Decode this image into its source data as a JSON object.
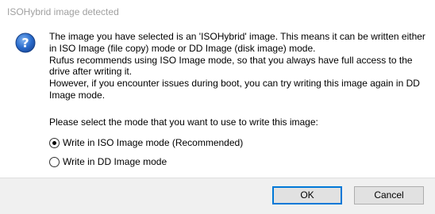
{
  "window": {
    "title": "ISOHybrid image detected"
  },
  "icon": {
    "name": "question-icon",
    "glyph": "?",
    "color": "#1f5fbf"
  },
  "message": {
    "lines": [
      "The image you have selected is an 'ISOHybrid' image. This means it can be written either",
      "in ISO Image (file copy) mode or DD Image (disk image) mode.",
      "Rufus recommends using ISO Image mode, so that you always have full access to the",
      "drive after writing it.",
      "However, if you encounter issues during boot, you can try writing this image again in DD",
      "Image mode."
    ]
  },
  "prompt": "Please select the mode that you want to use to write this image:",
  "options": [
    {
      "label": "Write in ISO Image mode (Recommended)",
      "selected": true
    },
    {
      "label": "Write in DD Image mode",
      "selected": false
    }
  ],
  "buttons": {
    "ok_label": "OK",
    "cancel_label": "Cancel"
  },
  "colors": {
    "title_text": "#a0a0a0",
    "footer_bg": "#f0f0f0",
    "accent": "#0078d7"
  }
}
